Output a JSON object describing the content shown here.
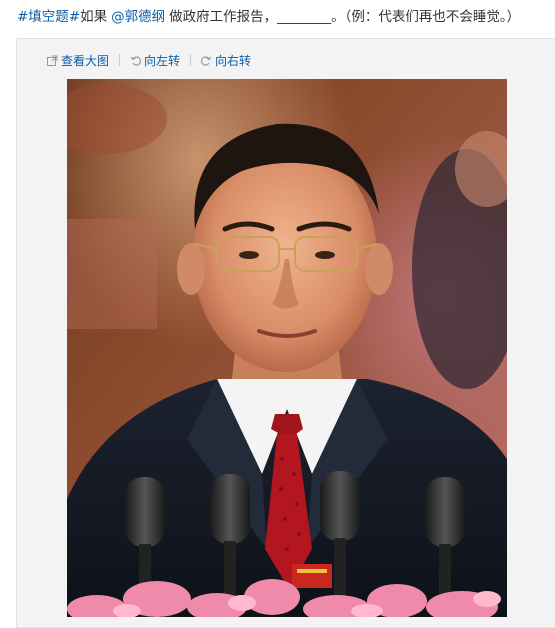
{
  "post": {
    "hashtag": "#填空题#",
    "prefix": "如果",
    "mention": "@郭德纲",
    "body": "做政府工作报告，________。（例：代表们再也不会睡觉。）"
  },
  "toolbar": {
    "view_large": "查看大图",
    "rotate_left": "向左转",
    "rotate_right": "向右转"
  },
  "photo": {
    "subject": "man in suit and glasses speaking at podium with microphones and pink flowers"
  },
  "icons": {
    "view_large": "external-link-icon",
    "rotate_left": "rotate-left-icon",
    "rotate_right": "rotate-right-icon"
  },
  "colors": {
    "link": "#0a5ea8",
    "text": "#333333",
    "panel": "#f3f3f3"
  }
}
